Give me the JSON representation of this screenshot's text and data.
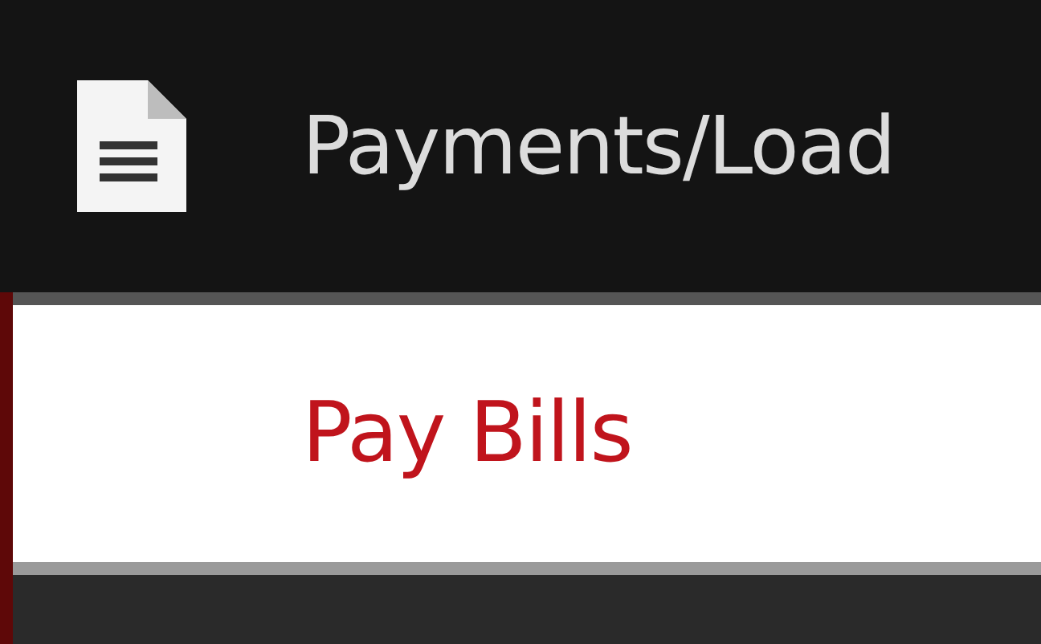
{
  "menu": {
    "title": "Payments/Load",
    "items": [
      {
        "label": "Pay Bills"
      }
    ]
  }
}
